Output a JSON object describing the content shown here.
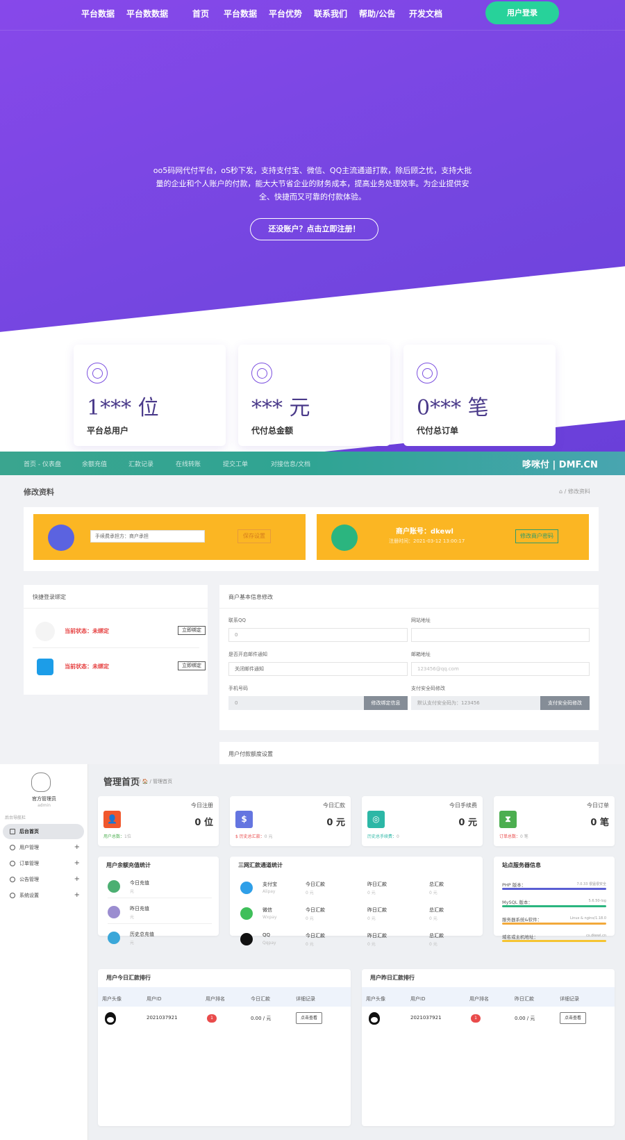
{
  "nav": {
    "brand_left": "平台数据",
    "brand_left2": "平台数数据",
    "items": [
      "首页",
      "平台数据",
      "平台优势",
      "联系我们",
      "帮助/公告",
      "开发文档"
    ],
    "login_label": "用户登录"
  },
  "hero": {
    "desc": "oo5码网代付平台，oS秒下发，支持支付宝、微信、QQ主流通道打款，除后顾之忧，支持大批量的企业和个人账户的付款，能大大节省企业的财务成本，提高业务处理效率。为企业提供安全、快捷而又可靠的付款体验。",
    "register_label": "还没账户？点击立即注册！"
  },
  "stats": [
    {
      "icon": "users-icon",
      "value": "1*** 位",
      "label": "平台总用户"
    },
    {
      "icon": "coins-icon",
      "value": "*** 元",
      "label": "代付总金额"
    },
    {
      "icon": "wallet-icon",
      "value": "0*** 笔",
      "label": "代付总订单"
    }
  ],
  "merchant_nav": {
    "items": [
      "首页 - 仪表盘",
      "余额充值",
      "汇款记录",
      "在线转账",
      "提交工单",
      "对接信息/文档"
    ],
    "logo": "哆咪付 | DMF.CN"
  },
  "profile": {
    "title": "修改资料",
    "breadcrumb": "⌂ / 修改资料",
    "fee_select": "手续费承担方：商户承担",
    "save_label": "保存设置",
    "account_label": "商户账号：dkewl",
    "register_time": "注册时间：2021-03-12 13:00:17",
    "change_pwd_label": "修改商户密码"
  },
  "quick_login": {
    "title": "快捷登录绑定",
    "rows": [
      {
        "icon": "qq-icon",
        "status": "当前状态：未绑定",
        "button": "立即绑定"
      },
      {
        "icon": "alipay-icon",
        "status": "当前状态：未绑定",
        "button": "立即绑定"
      }
    ]
  },
  "basic_info": {
    "title": "商户基本信息修改",
    "qq_label": "联系QQ",
    "qq_value": "0",
    "site_label": "网站地址",
    "site_value": "",
    "email_notify_label": "是否开启邮件通知",
    "email_notify_value": "关闭邮件通知",
    "email_label": "邮箱地址",
    "email_placeholder": "123456@qq.com",
    "phone_label": "手机号码",
    "phone_value": "0",
    "phone_btn": "修改绑定信息",
    "pay_pwd_label": "支付安全码修改",
    "pay_pwd_placeholder": "默认支付安全码为：123456",
    "pay_pwd_btn": "支付安全码修改"
  },
  "pay_limit_title": "用户付款额度设置",
  "admin": {
    "sidebar": {
      "user_name": "官方管理员",
      "user_role": "admin",
      "nav_title": "后台导航栏",
      "items": [
        {
          "label": "后台首页",
          "active": true
        },
        {
          "label": "用户管理",
          "expand": "+"
        },
        {
          "label": "订单管理",
          "expand": "+"
        },
        {
          "label": "公告管理",
          "expand": "+"
        },
        {
          "label": "系统设置",
          "expand": "+"
        }
      ]
    },
    "title": "管理首页",
    "crumb": "/ 🏠 / 管理首页",
    "kpis": [
      {
        "title": "今日注册",
        "value": "0 位",
        "foot": "用户总数：",
        "foot_val": "1位",
        "color": "#f0572c",
        "glyph": "👤"
      },
      {
        "title": "今日汇款",
        "value": "0 元",
        "foot": "$ 历史总汇款：",
        "foot_val": "0 元",
        "color": "#6475e0",
        "glyph": "$"
      },
      {
        "title": "今日手续费",
        "value": "0 元",
        "foot": "历史总手续费：",
        "foot_val": "0",
        "color": "#2cb7a6",
        "glyph": "◎"
      },
      {
        "title": "今日订单",
        "value": "0 笔",
        "foot": "订单总数：",
        "foot_val": "0 笔",
        "color": "#4cae50",
        "glyph": "⧗"
      }
    ],
    "recharge": {
      "title": "用户余额充值统计",
      "rows": [
        {
          "name": "今日充值",
          "sub": "元",
          "color": "#4caf72"
        },
        {
          "name": "昨日充值",
          "sub": "元",
          "color": "#9b8dd0"
        },
        {
          "name": "历史总充值",
          "sub": "元",
          "color": "#3aa7d9"
        }
      ]
    },
    "channels": {
      "title": "三网汇款通道统计",
      "cols": [
        "今日汇款",
        "昨日汇款",
        "总汇款"
      ],
      "rows": [
        {
          "name": "支付宝",
          "sub": "Alipay",
          "vals": [
            "0 元",
            "0 元",
            "0 元"
          ],
          "color": "#2f9fe8"
        },
        {
          "name": "微信",
          "sub": "Wxpay",
          "vals": [
            "0 元",
            "0 元",
            "0 元"
          ],
          "color": "#3fbf5a"
        },
        {
          "name": "QQ",
          "sub": "Qqpay",
          "vals": [
            "0 元",
            "0 元",
            "0 元"
          ],
          "color": "#111111"
        }
      ]
    },
    "server": {
      "title": "站点服务器信息",
      "rows": [
        {
          "label": "PHP 版本：",
          "value": "7.0.33 很猛很安全",
          "color": "#5a5ed3"
        },
        {
          "label": "MySQL 版本：",
          "value": "5.6.50-log",
          "color": "#2bb57f"
        },
        {
          "label": "服务器系统&软件：",
          "value": "Linux & nginx/1.18.0",
          "color": "#f2a93b"
        },
        {
          "label": "域名或主机地址：",
          "value": "cs.dkewl.cn",
          "color": "#f5c431"
        }
      ]
    },
    "rank_today": {
      "title": "用户今日汇款排行",
      "headers": [
        "用户头像",
        "用户ID",
        "用户排名",
        "今日汇款",
        "详细记录"
      ],
      "row": {
        "id": "2021037921",
        "rank": "1",
        "amount": "0.00 / 元",
        "btn": "点击查看"
      }
    },
    "rank_yesterday": {
      "title": "用户昨日汇款排行",
      "headers": [
        "用户头像",
        "用户ID",
        "用户排名",
        "昨日汇款",
        "详细记录"
      ],
      "row": {
        "id": "2021037921",
        "rank": "1",
        "amount": "0.00 / 元",
        "btn": "点击查看"
      }
    }
  }
}
